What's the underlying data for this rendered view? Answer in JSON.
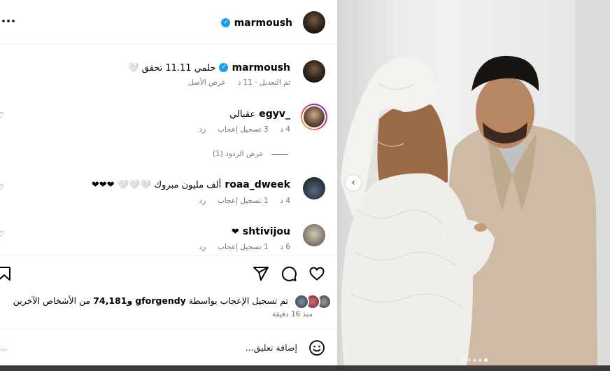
{
  "header": {
    "username": "marmoush",
    "more_icon": "more-horizontal-icon"
  },
  "caption": {
    "username": "marmoush",
    "text": "حلمي 11.11 تحقق 🤍",
    "edited": "تم التعديل",
    "time": "11 د",
    "see_translation": "عرض الأصل"
  },
  "comments": [
    {
      "username": "_egyv",
      "text": "عقبالي",
      "time": "4 د",
      "likes": "3 تسجيل إعجاب",
      "reply": "رد"
    },
    {
      "username": "roaa_dweek",
      "text": "ألف مليون مبروك 🤍🤍🤍 ❤❤❤",
      "time": "4 د",
      "likes": "1 تسجيل إعجاب",
      "reply": "رد"
    },
    {
      "username": "shtivijou",
      "text": "❤",
      "time": "6 د",
      "likes": "1 تسجيل إعجاب",
      "reply": "رد"
    }
  ],
  "view_replies": "عرض الردود (1)",
  "likes": {
    "prefix": "تم تسجيل الإعجاب بواسطة",
    "user": "gforgendy",
    "and": "و74,181",
    "suffix": "من الأشخاص الآخرين"
  },
  "post_time": "منذ 16 دقيقة",
  "comment_input": {
    "placeholder": "إضافة تعليق...",
    "post_label": "نشر"
  },
  "colors": {
    "verified": "#1d9bf0",
    "muted": "#737373",
    "story_ring_start": "#f9ce34",
    "story_ring_end": "#ee2a7b"
  },
  "carousel": {
    "count": 5,
    "active": 5
  }
}
